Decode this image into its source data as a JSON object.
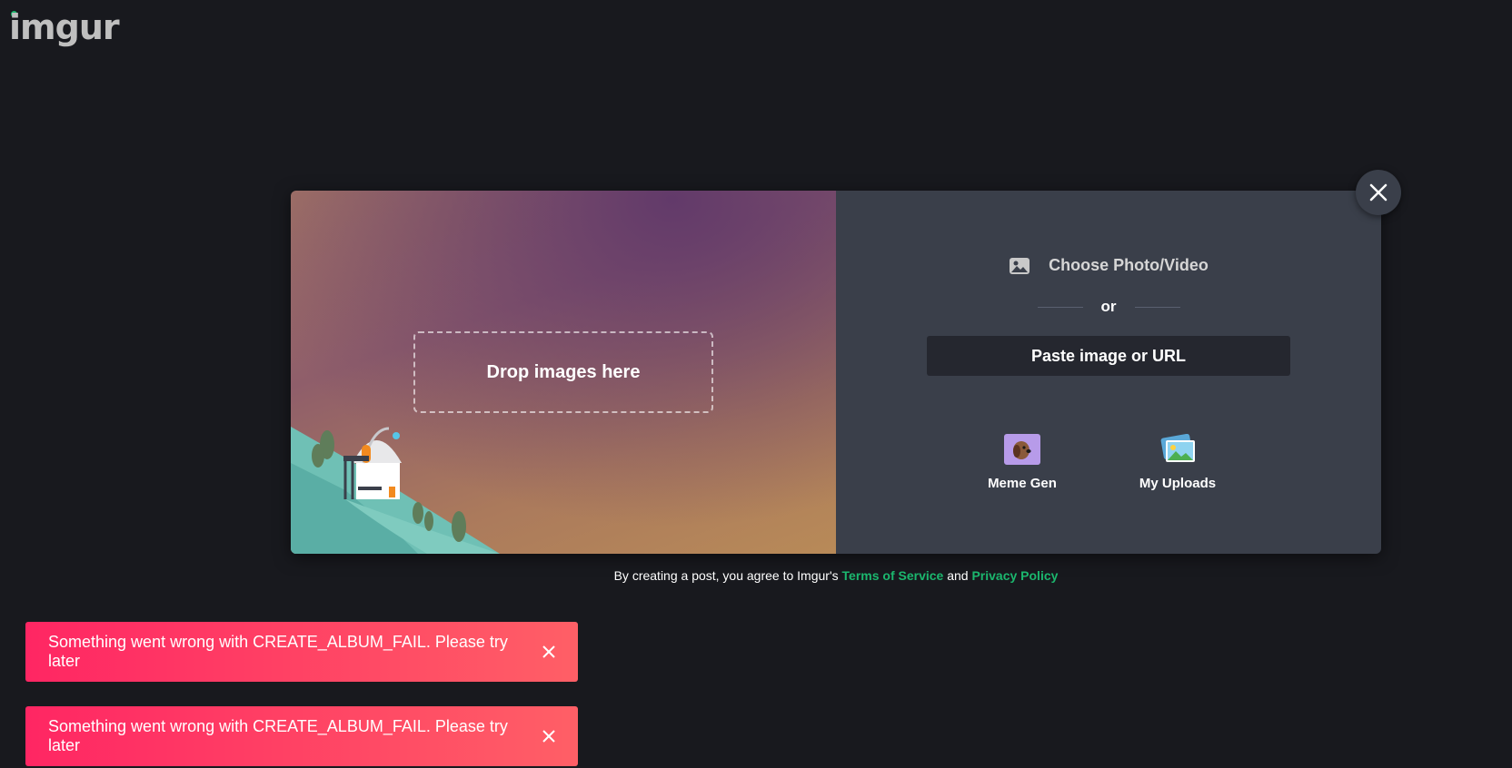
{
  "header": {
    "logo_text": "imgur"
  },
  "upload": {
    "drop_label": "Drop images here",
    "choose_label": "Choose Photo/Video",
    "or_label": "or",
    "paste_label": "Paste image or URL",
    "tools": [
      {
        "label": "Meme Gen",
        "icon": "meme-gen-icon"
      },
      {
        "label": "My Uploads",
        "icon": "my-uploads-icon"
      }
    ],
    "close_icon": "close-icon"
  },
  "agreement": {
    "prefix": "By creating a post, you agree to Imgur's",
    "terms_link": "Terms of Service",
    "conjunction": "and",
    "privacy_link": "Privacy Policy"
  },
  "toasts": [
    {
      "message": "Something went wrong with CREATE_ALBUM_FAIL. Please try later"
    },
    {
      "message": "Something went wrong with CREATE_ALBUM_FAIL. Please try later"
    }
  ],
  "colors": {
    "background": "#18191e",
    "accent_green": "#1bb76e",
    "toast_start": "#ff2663",
    "toast_end": "#ff5f66",
    "panel": "#3a3f4a"
  }
}
